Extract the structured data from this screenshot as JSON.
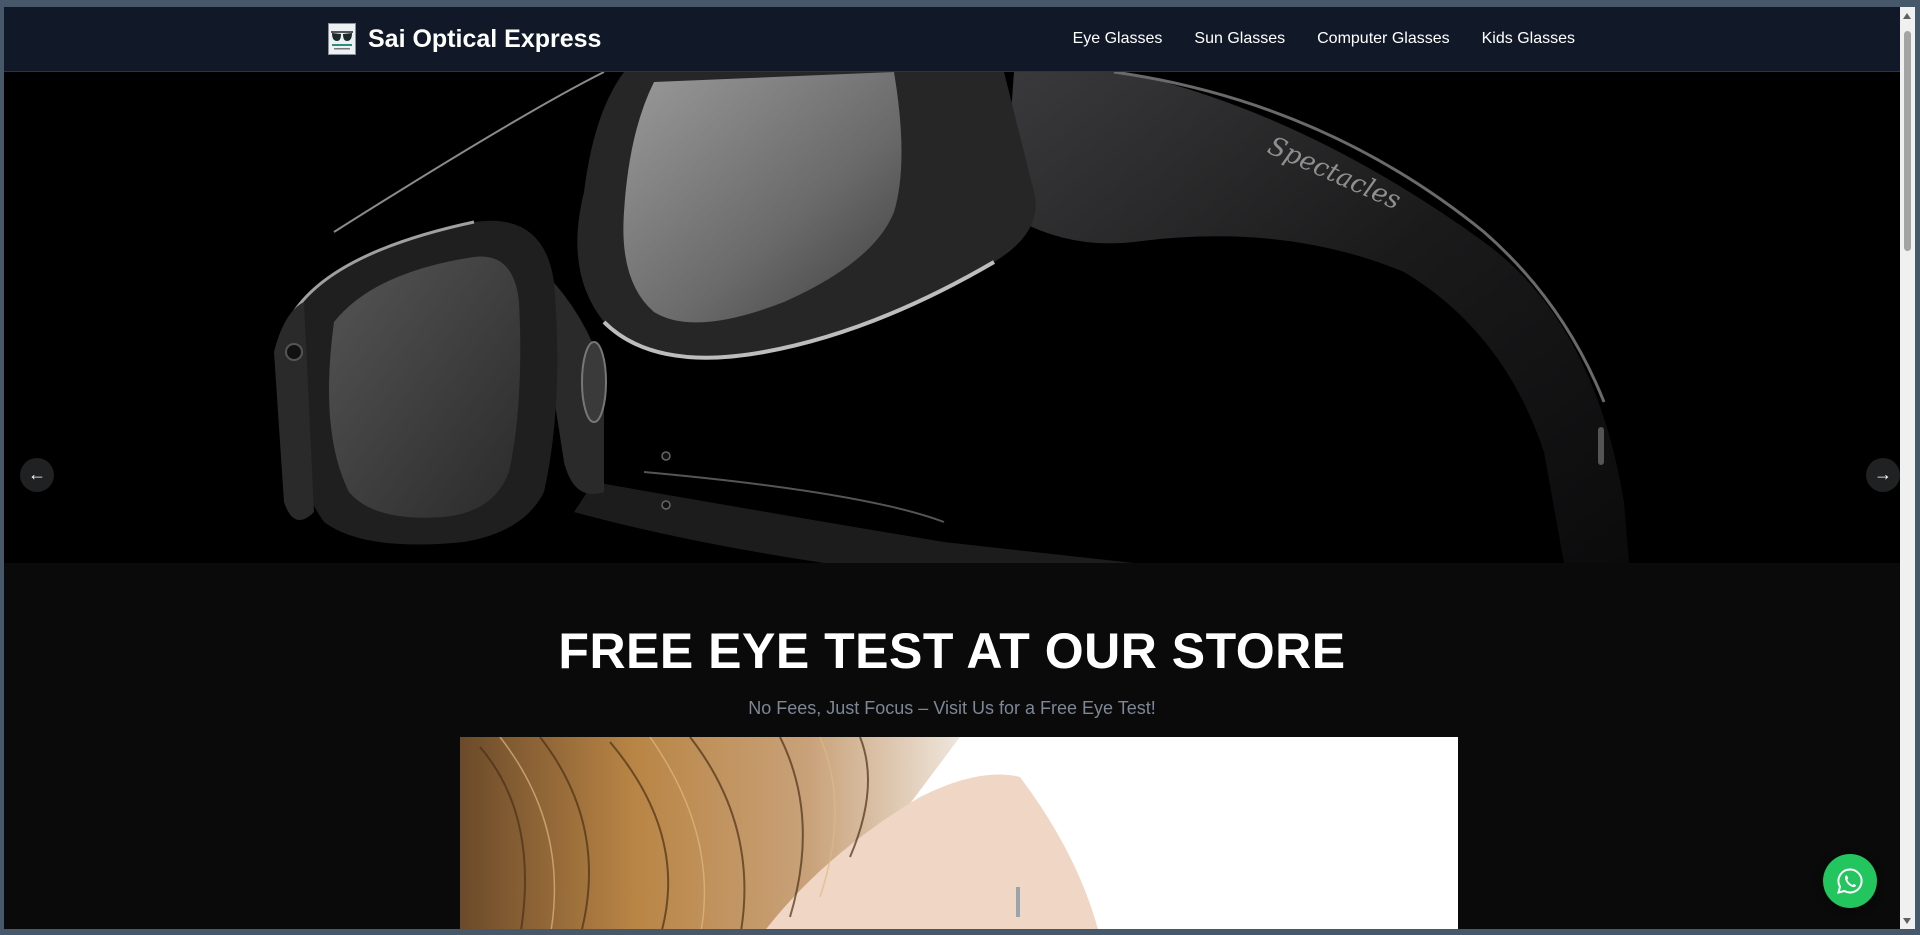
{
  "brand": {
    "name": "Sai Optical Express",
    "logo_icon": "sunglasses-logo-icon"
  },
  "nav": {
    "links": [
      {
        "label": "Eye Glasses"
      },
      {
        "label": "Sun Glasses"
      },
      {
        "label": "Computer Glasses"
      },
      {
        "label": "Kids Glasses"
      }
    ]
  },
  "hero": {
    "image_brand_text": "Spectacles",
    "prev_label": "←",
    "next_label": "→",
    "prev_icon": "arrow-left-icon",
    "next_icon": "arrow-right-icon"
  },
  "promo": {
    "title": "FREE EYE TEST AT OUR STORE",
    "subtitle": "No Fees, Just Focus – Visit Us for a Free Eye Test!"
  },
  "whatsapp": {
    "icon": "whatsapp-icon",
    "color": "#22c55e"
  },
  "colors": {
    "navbar": "#111827",
    "page": "#0a0a0b",
    "subtitle": "#7d8796"
  }
}
